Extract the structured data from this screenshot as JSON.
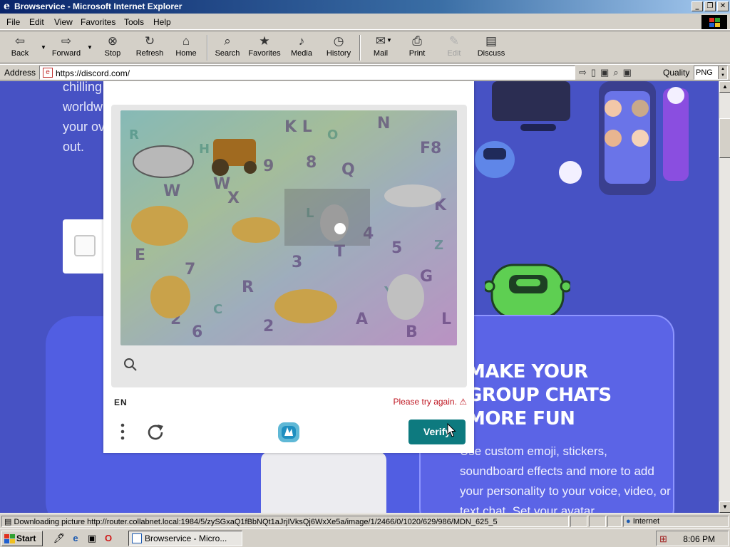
{
  "window": {
    "title": "Browservice - Microsoft Internet Explorer",
    "app_icon": "ie-icon"
  },
  "menu": [
    "File",
    "Edit",
    "View",
    "Favorites",
    "Tools",
    "Help"
  ],
  "toolbar": {
    "back": "Back",
    "forward": "Forward",
    "stop": "Stop",
    "refresh": "Refresh",
    "home": "Home",
    "search": "Search",
    "favorites": "Favorites",
    "media": "Media",
    "history": "History",
    "mail": "Mail",
    "print": "Print",
    "edit": "Edit",
    "discuss": "Discuss"
  },
  "address": {
    "label": "Address",
    "url": "https://discord.com/",
    "quality_label": "Quality",
    "quality_value": "PNG"
  },
  "page": {
    "bg_lines": [
      "chilling",
      "worldw",
      "your ov",
      "out."
    ],
    "heading": "MAKE YOUR GROUP CHATS MORE FUN",
    "heading_lines": [
      "MAKE YOUR",
      "GROUP CHATS",
      "MORE FUN"
    ],
    "heading_visible": [
      "MAKE YOUR",
      "GROUP CHATS",
      "MORE FUN"
    ],
    "paragraph": "Use custom emoji, stickers, soundboard effects and more to add your personality to your voice, video, or text chat. Set your avatar"
  },
  "captcha": {
    "language": "EN",
    "error": "Please try again. ⚠",
    "verify_label": "Verify"
  },
  "status": {
    "text": "Downloading picture http://router.collabnet.local:1984/5/zySGxaQ1fBbNQt1aJrjIVksQj6WxXe5a/image/1/2466/0/1020/629/986/MDN_625_5",
    "zone": "Internet"
  },
  "taskbar": {
    "start": "Start",
    "task": "Browservice - Micro...",
    "clock": "8:06 PM"
  }
}
